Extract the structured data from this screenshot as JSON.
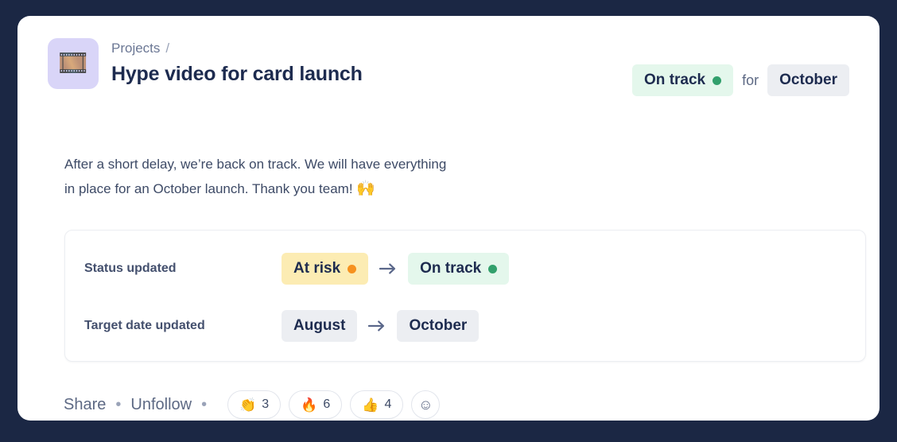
{
  "theme": {
    "backdrop": "#1b2744",
    "card_bg": "#ffffff",
    "title_color": "#1d2b4f",
    "muted_text": "#5d6984",
    "green_pill_bg": "#e4f7ec",
    "green_dot": "#32a06c",
    "yellow_pill_bg": "#fcecb3",
    "orange_dot": "#f6911e",
    "gray_pill_bg": "#eceef2",
    "icon_tile_bg": "#d9d5f8"
  },
  "header": {
    "app_icon": "film-frames-emoji",
    "app_icon_glyph": "🎞️",
    "breadcrumb_parent": "Projects",
    "breadcrumb_separator": "/",
    "title": "Hype video for card launch",
    "status": {
      "label": "On track",
      "dot": "green-dot"
    },
    "connector": "for",
    "target_date": "October"
  },
  "update": {
    "body_line_1": "After a short delay, we’re back on track. We will have everything",
    "body_line_2": "in place for an October launch. Thank you team!",
    "body_emoji": "🙌"
  },
  "changes": {
    "rows": [
      {
        "label": "Status updated",
        "from": {
          "text": "At risk",
          "dot": "orange-dot",
          "style": "yellow"
        },
        "arrow": "→",
        "to": {
          "text": "On track",
          "dot": "green-dot",
          "style": "green"
        }
      },
      {
        "label": "Target date updated",
        "from": {
          "text": "August",
          "dot": "",
          "style": "gray"
        },
        "arrow": "→",
        "to": {
          "text": "October",
          "dot": "",
          "style": "gray"
        }
      }
    ]
  },
  "footer": {
    "share_label": "Share",
    "separator_1": "•",
    "unfollow_label": "Unfollow",
    "separator_2": "•",
    "reactions": [
      {
        "emoji": "👏",
        "name": "clap-reaction",
        "count": "3"
      },
      {
        "emoji": "🔥",
        "name": "fire-reaction",
        "count": "6"
      },
      {
        "emoji": "👍",
        "name": "thumbs-up-reaction",
        "count": "4"
      }
    ],
    "add_reaction_glyph": "☺",
    "add_reaction_name": "add-reaction-button"
  }
}
